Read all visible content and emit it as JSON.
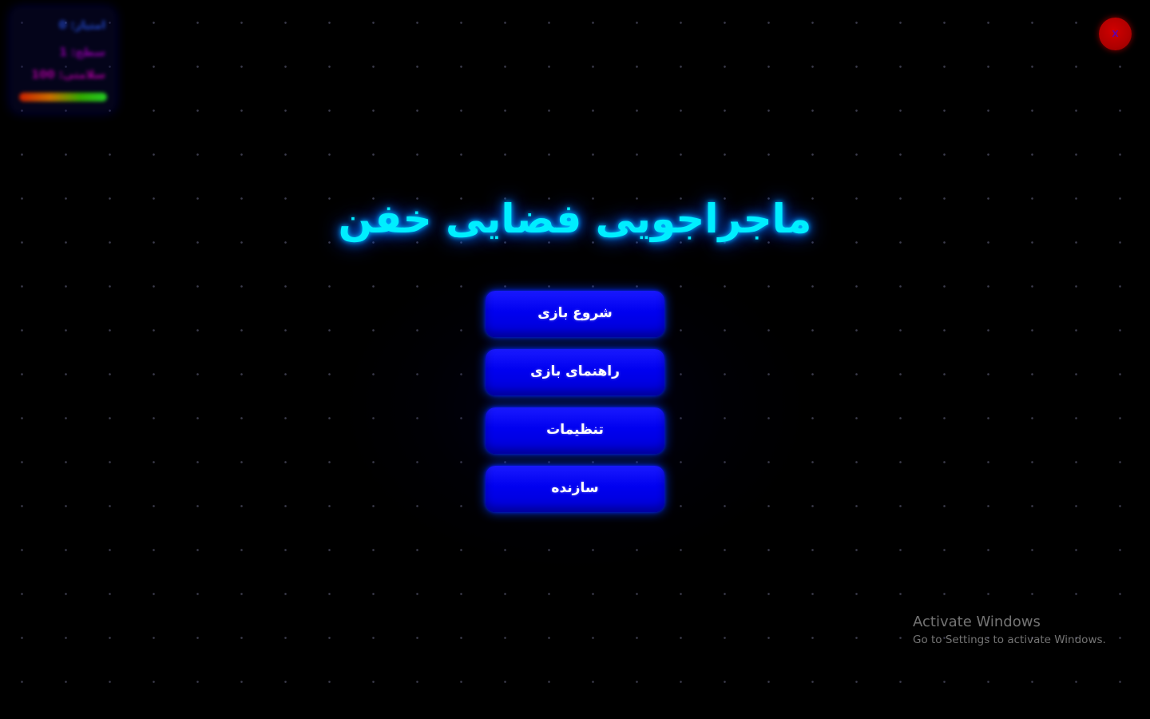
{
  "hud": {
    "score_label": "امتیاز: 0",
    "level_label": "سطح: 1",
    "health_label": "سلامتی: 100",
    "health_fraction": 1.0
  },
  "close_button": {
    "label": "X"
  },
  "title": "ماجراجویی فضایی خفن",
  "menu": {
    "items": [
      {
        "label": "شروع بازی"
      },
      {
        "label": "راهنمای بازی"
      },
      {
        "label": "تنظیمات"
      },
      {
        "label": "سازنده"
      }
    ]
  },
  "watermark": {
    "title": "Activate Windows",
    "subtitle": "Go to Settings to activate Windows."
  },
  "colors": {
    "background": "#000000",
    "title": "#00eeff",
    "button": "#0000f0",
    "close_button": "#c00000"
  }
}
